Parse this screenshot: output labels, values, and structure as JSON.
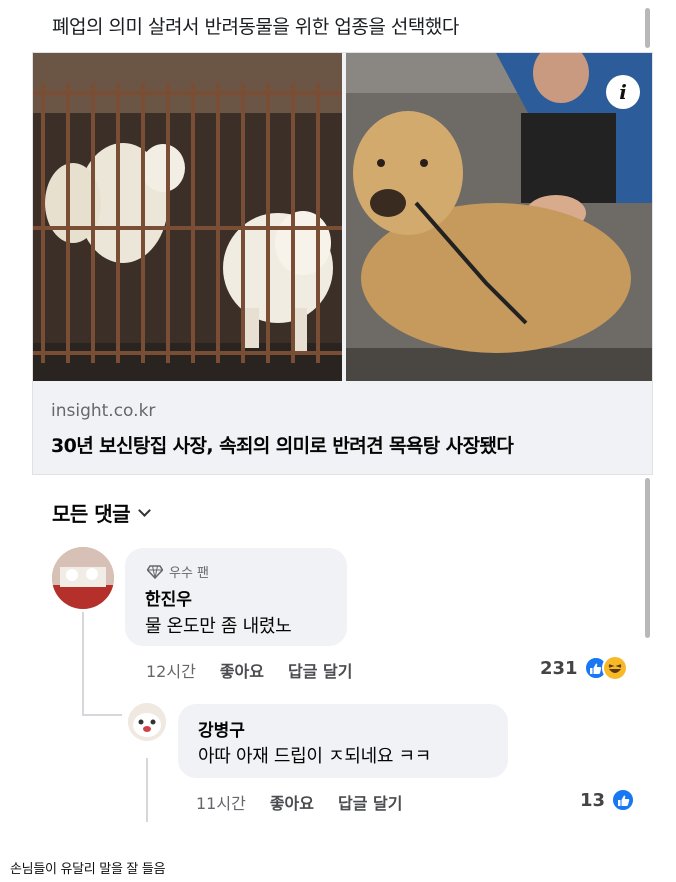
{
  "post": {
    "text": "폐업의 의미 살려서 반려동물을 위한 업종을 선택했다"
  },
  "link_card": {
    "domain": "insight.co.kr",
    "title": "30년 보신탕집 사장, 속죄의 의미로 반려견 목욕탕 사장됐다",
    "info_icon": "info-icon",
    "info_glyph": "i"
  },
  "comments_section": {
    "sort_label": "모든 댓글"
  },
  "comments": [
    {
      "badge": "우수 팬",
      "author": "한진우",
      "text": "물 온도만 좀 내렸노",
      "time": "12시간",
      "like_label": "좋아요",
      "reply_label": "답글 달기",
      "reaction_count": "231",
      "reactions": [
        "like",
        "haha"
      ]
    },
    {
      "author": "강병구",
      "text": "아따 아재 드립이 ㅈ되네요 ㅋㅋ",
      "time": "11시간",
      "like_label": "좋아요",
      "reply_label": "답글 달기",
      "reaction_count": "13",
      "reactions": [
        "like"
      ]
    }
  ],
  "caption": "손님들이 유달리 말을 잘 들음",
  "colors": {
    "like_blue": "#1877f2",
    "haha_yellow": "#f7b928",
    "bubble_bg": "#f0f2f5",
    "muted_text": "#65676b"
  }
}
